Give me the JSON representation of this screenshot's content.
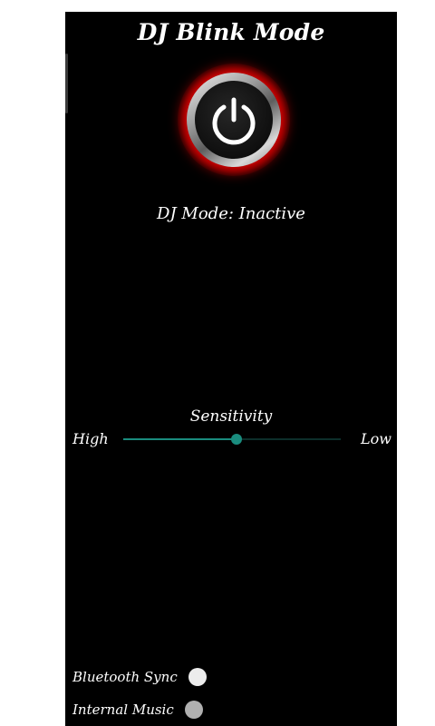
{
  "app": {
    "title": "DJ Blink Mode",
    "status_text": "DJ Mode: Inactive"
  },
  "power_button": {
    "icon": "power-icon",
    "glow_color": "#e00000"
  },
  "sensitivity": {
    "label": "Sensitivity",
    "high_label": "High",
    "low_label": "Low",
    "value": 0.52,
    "accent_color": "#1a8c7e"
  },
  "toggles": [
    {
      "label": "Bluetooth Sync",
      "knob_color": "#ececec"
    },
    {
      "label": "Internal Music",
      "knob_color": "#b0b0b0"
    }
  ]
}
